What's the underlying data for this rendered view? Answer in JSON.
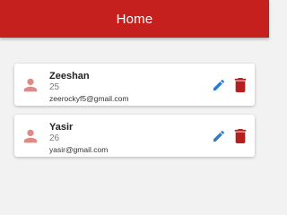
{
  "appbar": {
    "title": "Home",
    "color": "#c6201e"
  },
  "users": [
    {
      "name": "Zeeshan",
      "age": "25",
      "email": "zeerockyf5@gmail.com"
    },
    {
      "name": "Yasir",
      "age": "26",
      "email": "yasir@gmail.com"
    }
  ],
  "icons": {
    "avatar": "person-icon",
    "edit": "edit-icon",
    "delete": "delete-icon"
  },
  "colors": {
    "avatar": "#e08a86",
    "edit": "#2a7bd1",
    "delete": "#b51f1d"
  }
}
